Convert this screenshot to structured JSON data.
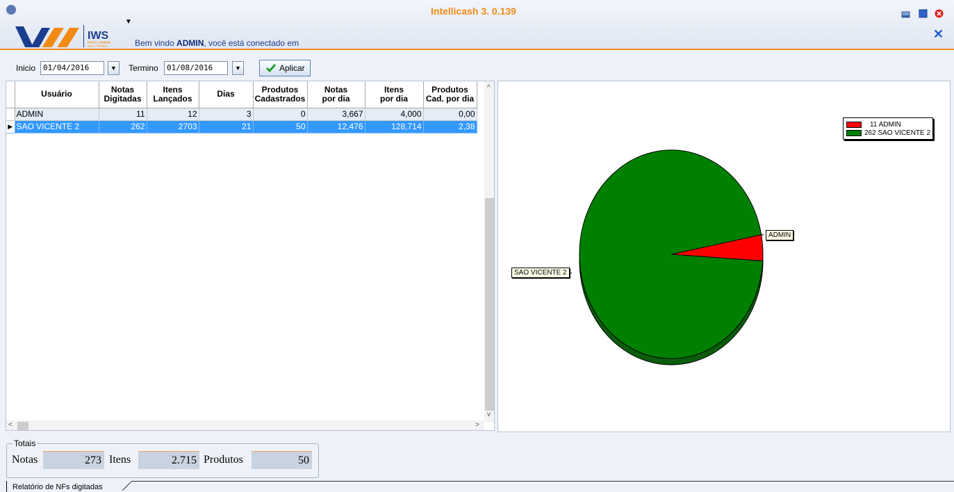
{
  "header": {
    "brand": "IWS",
    "brand_sub1": "INTELLIWARE",
    "brand_sub2": "SOLUTIONS",
    "welcome_prefix": "Bem vindo ",
    "welcome_user": "ADMIN",
    "welcome_suffix": ", você está conectado em",
    "app_title": "Intellicash 3. 0.139"
  },
  "filter": {
    "start_label": "Inicio",
    "start_value": "01/04/2016",
    "end_label": "Termino",
    "end_value": "01/08/2016",
    "apply_label": "Aplicar"
  },
  "grid": {
    "columns": [
      {
        "l1": "Usuário",
        "l2": ""
      },
      {
        "l1": "Notas",
        "l2": "Digitadas"
      },
      {
        "l1": "Itens",
        "l2": "Lançados"
      },
      {
        "l1": "Dias",
        "l2": ""
      },
      {
        "l1": "Produtos",
        "l2": "Cadastrados"
      },
      {
        "l1": "Notas",
        "l2": "por dia"
      },
      {
        "l1": "Itens",
        "l2": "por dia"
      },
      {
        "l1": "Produtos",
        "l2": "Cad. por dia"
      }
    ],
    "rows": [
      {
        "usuario": "ADMIN",
        "notas": "11",
        "itens": "12",
        "dias": "3",
        "produtos": "0",
        "notas_dia": "3,667",
        "itens_dia": "4,000",
        "prod_dia": "0,00"
      },
      {
        "usuario": "SAO VICENTE 2",
        "notas": "262",
        "itens": "2703",
        "dias": "21",
        "produtos": "50",
        "notas_dia": "12,476",
        "itens_dia": "128,714",
        "prod_dia": "2,38"
      }
    ]
  },
  "chart_data": {
    "type": "pie",
    "categories": [
      "ADMIN",
      "SAO VICENTE 2"
    ],
    "values": [
      11,
      262
    ],
    "colors": [
      "#ff0000",
      "#008000"
    ],
    "legend": [
      "11 ADMIN",
      "262 SAO VICENTE 2"
    ],
    "legend_position": "top-right"
  },
  "totals": {
    "title": "Totais",
    "notas_label": "Notas",
    "notas_value": "273",
    "itens_label": "Itens",
    "itens_value": "2.715",
    "produtos_label": "Produtos",
    "produtos_value": "50"
  },
  "tabs": {
    "active": "Relatório de NFs digitadas"
  }
}
